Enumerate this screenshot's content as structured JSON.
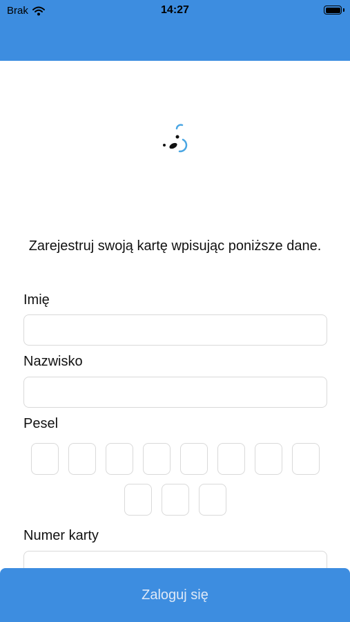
{
  "status_bar": {
    "carrier": "Brak",
    "time": "14:27"
  },
  "form": {
    "intro": "Zarejestruj swoją kartę wpisując poniższe dane.",
    "first_name_label": "Imię",
    "first_name_value": "",
    "last_name_label": "Nazwisko",
    "last_name_value": "",
    "pesel_label": "Pesel",
    "pesel_digits": [
      "",
      "",
      "",
      "",
      "",
      "",
      "",
      "",
      "",
      "",
      ""
    ],
    "card_number_label": "Numer karty",
    "card_number_value": ""
  },
  "actions": {
    "login_label": "Zaloguj się"
  },
  "colors": {
    "accent": "#3d8de0",
    "input_border": "#d9d9d9"
  }
}
